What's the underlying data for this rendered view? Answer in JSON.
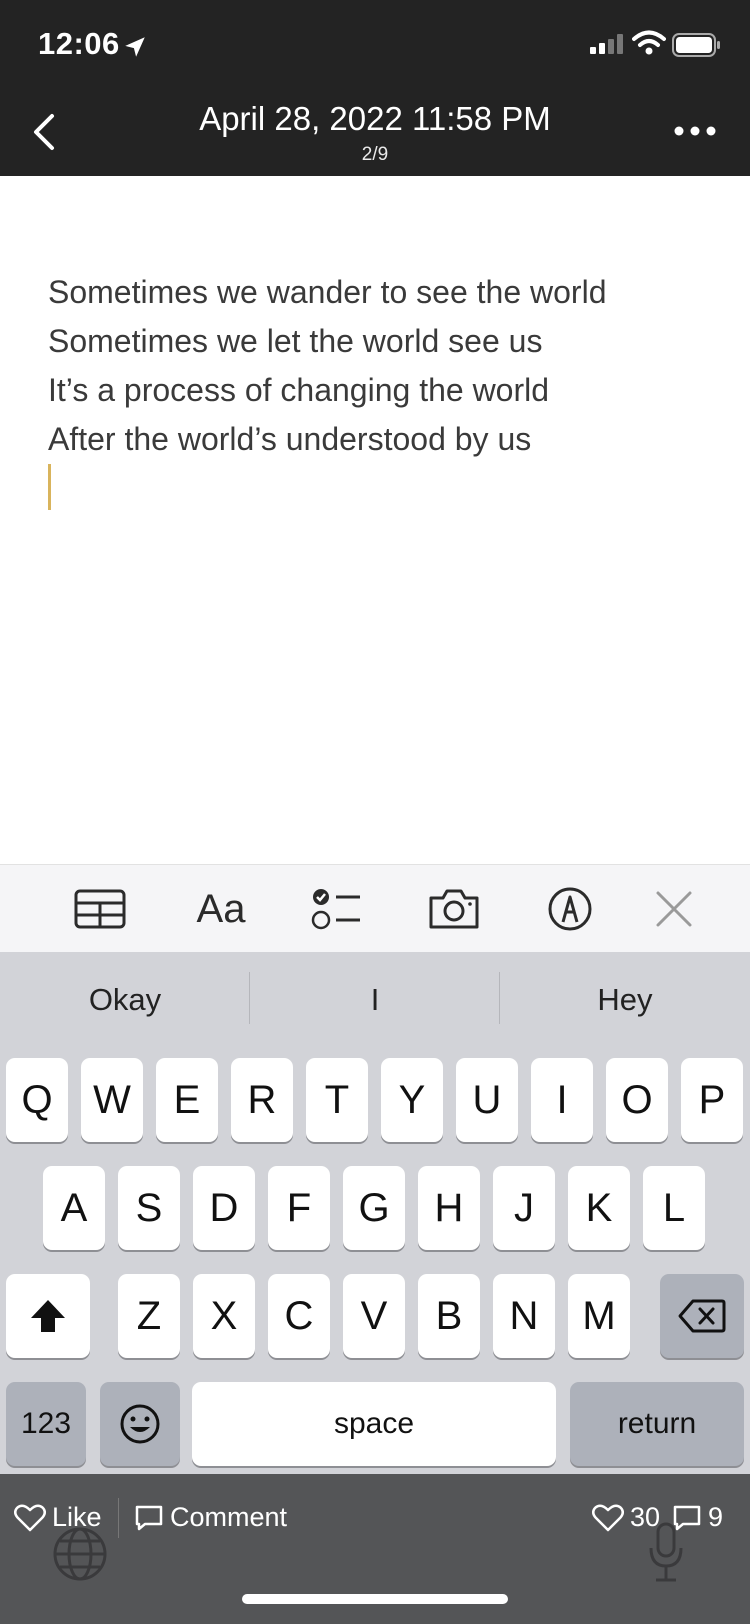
{
  "status": {
    "time": "12:06"
  },
  "header": {
    "title": "April 28, 2022 11:58 PM",
    "subtitle": "2/9"
  },
  "note": {
    "lines": [
      "Sometimes we wander to see the world",
      "Sometimes we let the world see us",
      "It’s a process of changing the world",
      "After the world’s understood by us"
    ]
  },
  "toolbar": {
    "font_label": "Aa"
  },
  "keyboard": {
    "suggestions": [
      "Okay",
      "I",
      "Hey"
    ],
    "row1": [
      "Q",
      "W",
      "E",
      "R",
      "T",
      "Y",
      "U",
      "I",
      "O",
      "P"
    ],
    "row2": [
      "A",
      "S",
      "D",
      "F",
      "G",
      "H",
      "J",
      "K",
      "L"
    ],
    "row3": [
      "Z",
      "X",
      "C",
      "V",
      "B",
      "N",
      "M"
    ],
    "numbers_label": "123",
    "space_label": "space",
    "return_label": "return"
  },
  "social": {
    "like_label": "Like",
    "comment_label": "Comment",
    "like_count": "30",
    "comment_count": "9"
  },
  "colors": {
    "header_bg": "#232323",
    "cursor": "#d9b45c",
    "keyboard_bg": "#d2d3d8",
    "bottom_bar": "#545557"
  }
}
